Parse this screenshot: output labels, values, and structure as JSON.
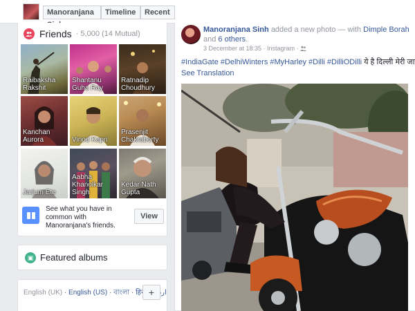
{
  "topbar": {
    "profile_name": "Manoranjana Sinh",
    "timeline_label": "Timeline",
    "recent_label": "Recent"
  },
  "friends": {
    "title": "Friends",
    "count": "· 5,000 (14 Mutual)",
    "tiles": [
      {
        "name": "Raibaksha Rakshit"
      },
      {
        "name": "Shantanu Guha Ray"
      },
      {
        "name": "Ratnadip Choudhury"
      },
      {
        "name": "Kanchan Aurora"
      },
      {
        "name": "Vinod Kapri"
      },
      {
        "name": "Prasenjit Chakraborty"
      },
      {
        "name": "Jarjum Ete"
      },
      {
        "name": "Aabha Khanolkar Singh"
      },
      {
        "name": "Kedar Nath Gupta"
      }
    ],
    "common_text": "See what you have in common with Manoranjana's friends.",
    "view_label": "View"
  },
  "albums": {
    "title": "Featured albums"
  },
  "languages": {
    "current": "English (UK)",
    "others": [
      "English (US)",
      "বাংলা",
      "हिन्दी",
      "اردو"
    ],
    "add_label": "+"
  },
  "post": {
    "author": "Manoranjana Sinh",
    "action": "added a new photo — with",
    "tagged": "Dimple Borah",
    "and": "and",
    "others": "6 others",
    "period": ".",
    "meta": "3 December at 18:35 · Instagram ·",
    "hashtags": "#IndiaGate #DelhiWinters #MyHarley #Dilli #DilliODilli",
    "hindi": "ये है दिल्ली मेरी जान",
    "heart": "💕",
    "see_translation": "See Translation"
  }
}
